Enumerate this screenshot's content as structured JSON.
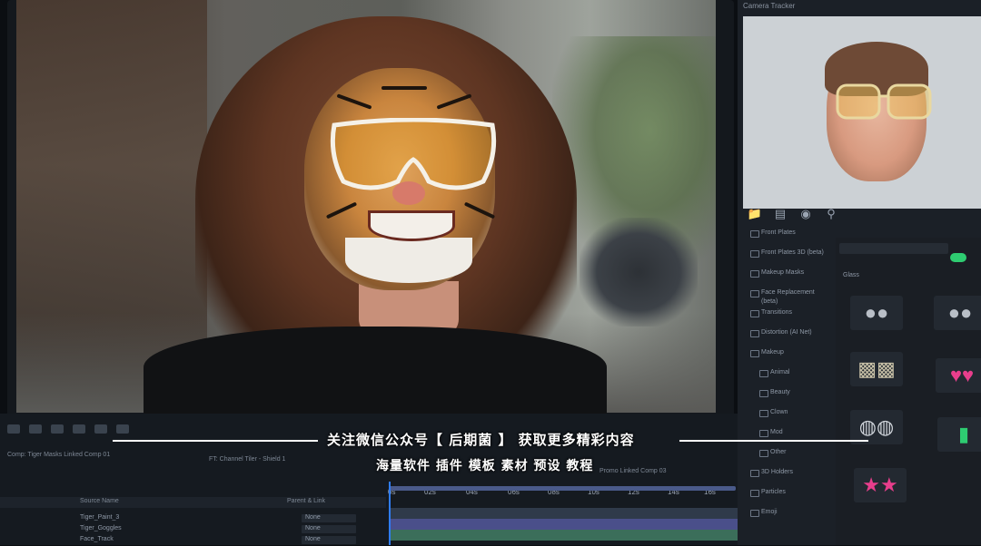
{
  "viewer": {
    "name": "video-preview"
  },
  "right_panel": {
    "tab_label": "Camera Tracker",
    "toolbar_icons": [
      "folder-icon",
      "document-icon",
      "camera-icon",
      "search-icon"
    ],
    "categories": [
      {
        "label": "Front Plates",
        "sub": false
      },
      {
        "label": "Front Plates 3D (beta)",
        "sub": false
      },
      {
        "label": "Makeup Masks",
        "sub": false
      },
      {
        "label": "Face Replacement (beta)",
        "sub": false
      },
      {
        "label": "Transitions",
        "sub": false
      },
      {
        "label": "Distortion (AI Net)",
        "sub": false
      },
      {
        "label": "Makeup",
        "sub": false
      },
      {
        "label": "Animal",
        "sub": true
      },
      {
        "label": "Beauty",
        "sub": true
      },
      {
        "label": "Clown",
        "sub": true
      },
      {
        "label": "Mod",
        "sub": true
      },
      {
        "label": "Other",
        "sub": true
      },
      {
        "label": "3D Holders",
        "sub": false
      },
      {
        "label": "Particles",
        "sub": false
      },
      {
        "label": "Emoji",
        "sub": false
      }
    ],
    "effects_label": "Glass",
    "effects": [
      "goggles",
      "goggles",
      "goggles",
      "hearts",
      "earrings",
      "tag",
      "stars"
    ],
    "accent": "#2ecc71"
  },
  "timeline": {
    "comp_tab": "Comp: Tiger Masks Linked Comp 01",
    "comp_tab2": "FT: Channel Tiler - Shield 1",
    "comp_tab3": "Promo Linked Comp 03",
    "ruler": [
      "0s",
      "02s",
      "04s",
      "06s",
      "08s",
      "10s",
      "12s",
      "14s",
      "16s"
    ],
    "header_source": "Source Name",
    "header_parent": "Parent & Link",
    "layers": [
      {
        "name": "Tiger_Paint_3",
        "parent": "None"
      },
      {
        "name": "Tiger_Goggles",
        "parent": "None"
      },
      {
        "name": "Face_Track",
        "parent": "None"
      }
    ],
    "playhead_color": "#2f7cf6"
  },
  "watermark": {
    "line1": "关注微信公众号【 后期菌 】 获取更多精彩内容",
    "line2": "海量软件 插件 模板 素材 预设 教程"
  }
}
